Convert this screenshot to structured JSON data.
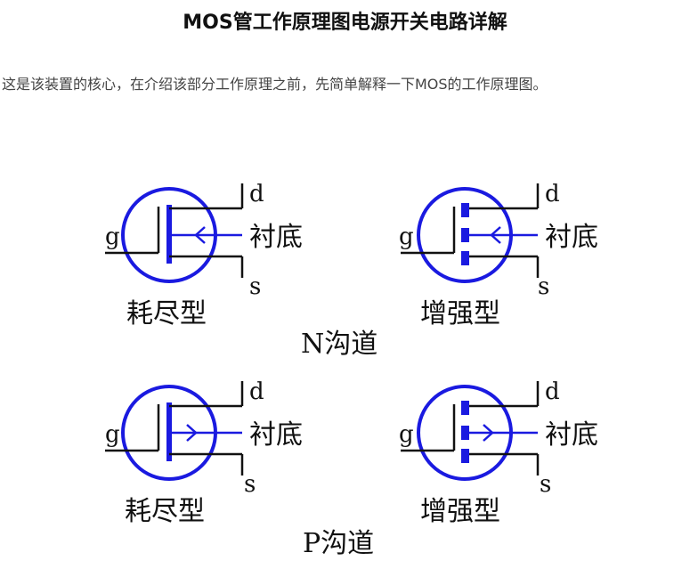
{
  "article": {
    "title": "MOS管工作原理图电源开关电路详解",
    "intro": "这是该装置的核心，在介绍该部分工作原理之前，先简单解释一下MOS的工作原理图。"
  },
  "diagram": {
    "stroke_color": "#1a1ae0",
    "wire_color": "#111111",
    "pins": {
      "gate": "g",
      "drain": "d",
      "source": "s",
      "substrate": "衬底"
    },
    "group_labels": {
      "n_channel": "N沟道",
      "p_channel": "P沟道"
    },
    "symbols": [
      {
        "id": "n-depletion",
        "type_label": "耗尽型",
        "channel": "N",
        "mode": "depletion"
      },
      {
        "id": "n-enhancement",
        "type_label": "增强型",
        "channel": "N",
        "mode": "enhancement"
      },
      {
        "id": "p-depletion",
        "type_label": "耗尽型",
        "channel": "P",
        "mode": "depletion"
      },
      {
        "id": "p-enhancement",
        "type_label": "增强型",
        "channel": "P",
        "mode": "enhancement"
      }
    ]
  }
}
